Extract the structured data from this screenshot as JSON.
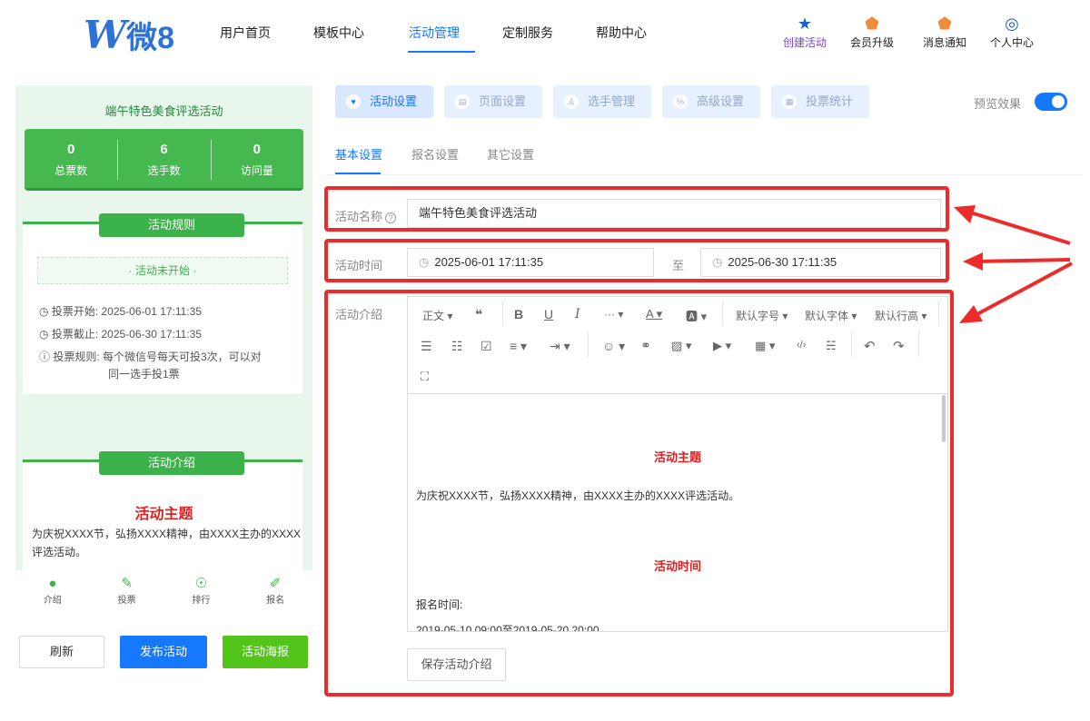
{
  "logo": {
    "mark": "W",
    "text": "微8"
  },
  "nav": {
    "items": [
      "用户首页",
      "模板中心",
      "活动管理",
      "定制服务",
      "帮助中心"
    ],
    "active": 2,
    "right": [
      {
        "label": "创建活动",
        "icon": "star-icon"
      },
      {
        "label": "会员升级",
        "icon": "badge-icon"
      },
      {
        "label": "消息通知",
        "icon": "bell-icon"
      },
      {
        "label": "个人中心",
        "icon": "user-icon"
      }
    ]
  },
  "preview": {
    "title": "端午特色美食评选活动",
    "stats": [
      {
        "value": "0",
        "label": "总票数"
      },
      {
        "value": "6",
        "label": "选手数"
      },
      {
        "value": "0",
        "label": "访问量"
      }
    ],
    "rules_title": "活动规则",
    "status": "· 活动未开始 ·",
    "rules": [
      "投票开始:  2025-06-01 17:11:35",
      "投票截止:  2025-06-30 17:11:35",
      "投票规则:  每个微信号每天可投3次，可以对",
      "同一选手投1票"
    ],
    "intro_section": "活动介绍",
    "intro_heading": "活动主题",
    "intro_text": "为庆祝XXXX节，弘扬XXXX精神，由XXXX主办的XXXX评选活动。",
    "tabs": [
      "介绍",
      "投票",
      "排行",
      "报名"
    ]
  },
  "actions": {
    "refresh": "刷新",
    "publish": "发布活动",
    "poster": "活动海报"
  },
  "main_tabs": [
    "活动设置",
    "页面设置",
    "选手管理",
    "高级设置",
    "投票统计"
  ],
  "preview_toggle": "预览效果",
  "sub_tabs": [
    "基本设置",
    "报名设置",
    "其它设置"
  ],
  "form": {
    "name_label": "活动名称",
    "name_value": "端午特色美食评选活动",
    "time_label": "活动时间",
    "start": "2025-06-01 17:11:35",
    "to": "至",
    "end": "2025-06-30 17:11:35",
    "intro_label": "活动介绍"
  },
  "editor": {
    "toolbar": {
      "paragraph": "正文",
      "font_size": "默认字号",
      "font_family": "默认字体",
      "line_height": "默认行高"
    },
    "content": {
      "h1": "活动主题",
      "p1": "为庆祝XXXX节，弘扬XXXX精神，由XXXX主办的XXXX评选活动。",
      "h2": "活动时间",
      "p2": "报名时间:",
      "p3": "2019-05-10 09:00至2019-05-20 20:00"
    },
    "save": "保存活动介绍"
  },
  "colors": {
    "primary": "#1677ff",
    "green": "#3cb24a",
    "highlight": "#ee2b2b"
  }
}
